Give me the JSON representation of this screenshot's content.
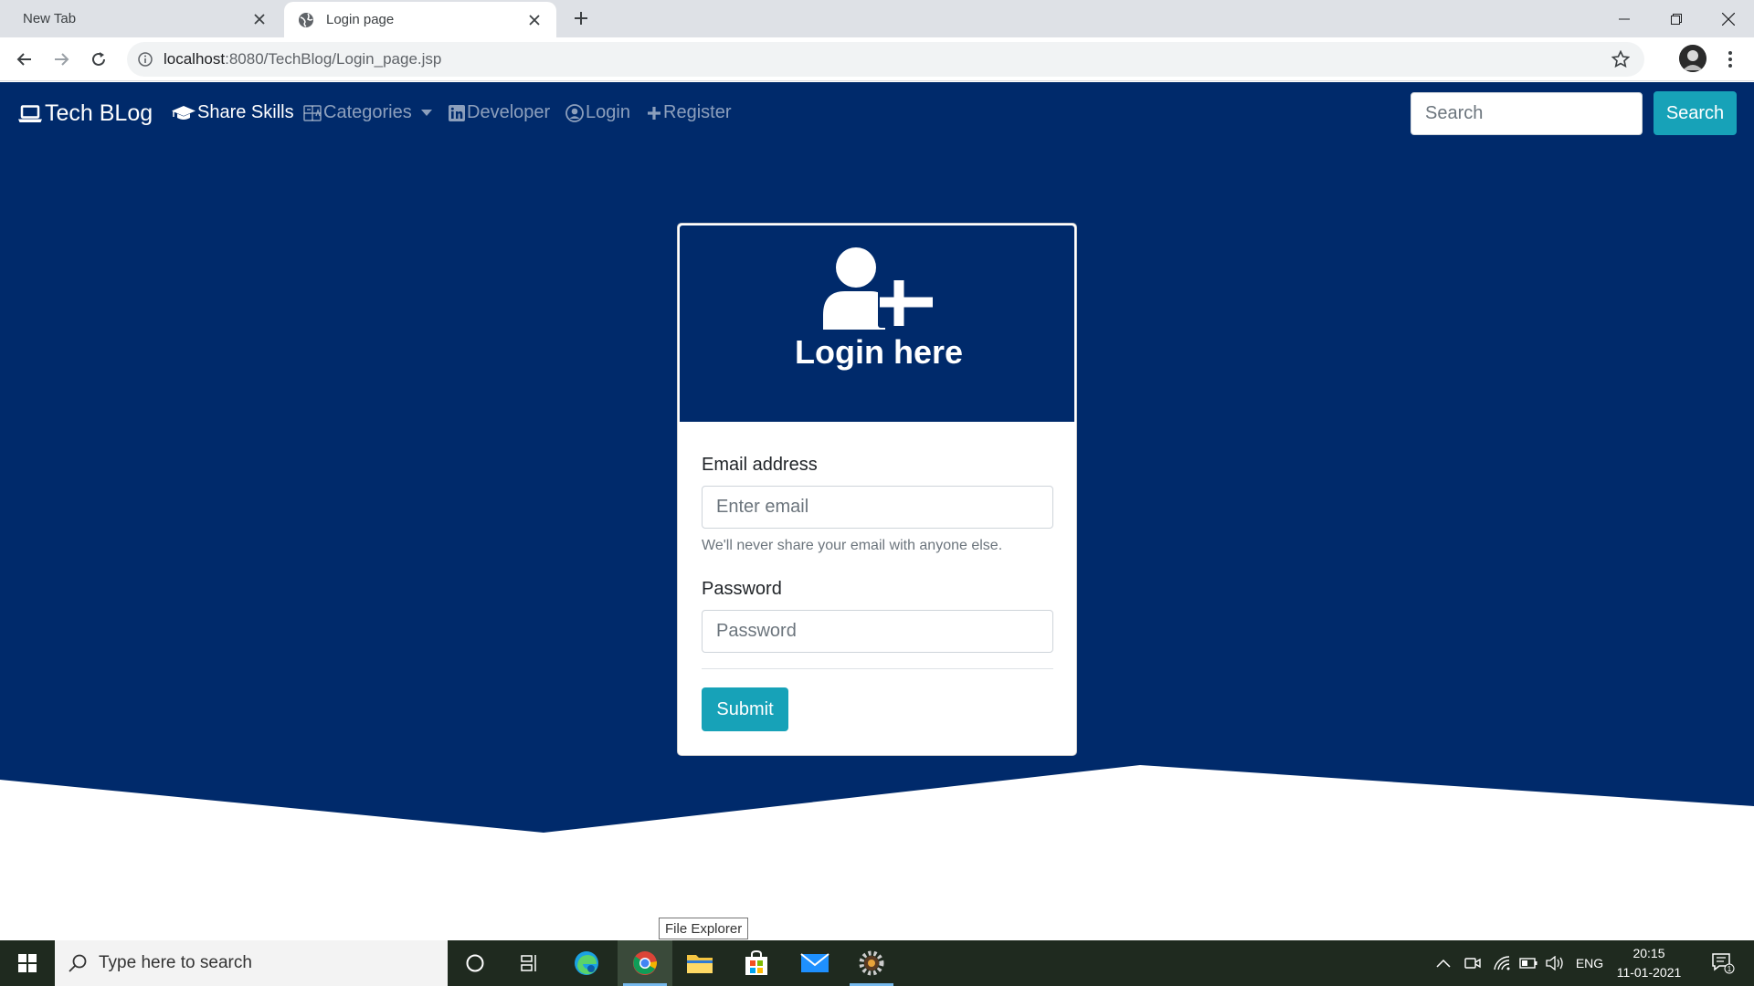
{
  "browser": {
    "tabs": [
      {
        "title": "New Tab",
        "active": false
      },
      {
        "title": "Login page",
        "active": true
      }
    ],
    "url_host": "localhost",
    "url_path": ":8080/TechBlog/Login_page.jsp"
  },
  "navbar": {
    "brand": "Tech BLog",
    "links": {
      "share_skills": "Share Skills",
      "categories": "Categories",
      "developer": "Developer",
      "login": "Login",
      "register": "Register"
    },
    "search_placeholder": "Search",
    "search_button": "Search"
  },
  "login_card": {
    "title": "Login here",
    "email_label": "Email address",
    "email_placeholder": "Enter email",
    "email_help": "We'll never share your email with anyone else.",
    "password_label": "Password",
    "password_placeholder": "Password",
    "submit_label": "Submit"
  },
  "tooltip": "File Explorer",
  "taskbar": {
    "search_placeholder": "Type here to search",
    "language": "ENG",
    "time": "20:15",
    "date": "11-01-2021",
    "notification_count": "1"
  },
  "colors": {
    "primary_navy": "#002a6b",
    "accent_teal": "#17a2b8"
  }
}
